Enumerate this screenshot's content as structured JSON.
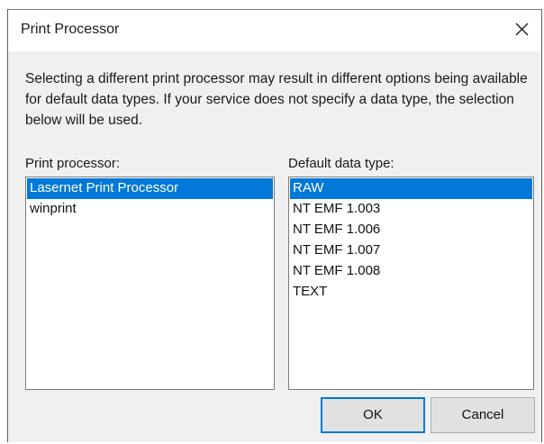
{
  "dialog": {
    "title": "Print Processor",
    "description": "Selecting a different print processor may result in different options being available for default data types. If your service does not specify a data type, the selection below will be used."
  },
  "print_processor": {
    "label": "Print processor:",
    "items": [
      {
        "label": "Lasernet Print Processor",
        "selected": true
      },
      {
        "label": "winprint",
        "selected": false
      }
    ]
  },
  "default_data_type": {
    "label": "Default data type:",
    "items": [
      {
        "label": "RAW",
        "selected": true
      },
      {
        "label": "NT EMF 1.003",
        "selected": false
      },
      {
        "label": "NT EMF 1.006",
        "selected": false
      },
      {
        "label": "NT EMF 1.007",
        "selected": false
      },
      {
        "label": "NT EMF 1.008",
        "selected": false
      },
      {
        "label": "TEXT",
        "selected": false
      }
    ]
  },
  "buttons": {
    "ok_label": "OK",
    "cancel_label": "Cancel"
  },
  "icons": {
    "close": "close-icon"
  },
  "colors": {
    "selection": "#0078d7",
    "default_button_border": "#0078d7"
  }
}
